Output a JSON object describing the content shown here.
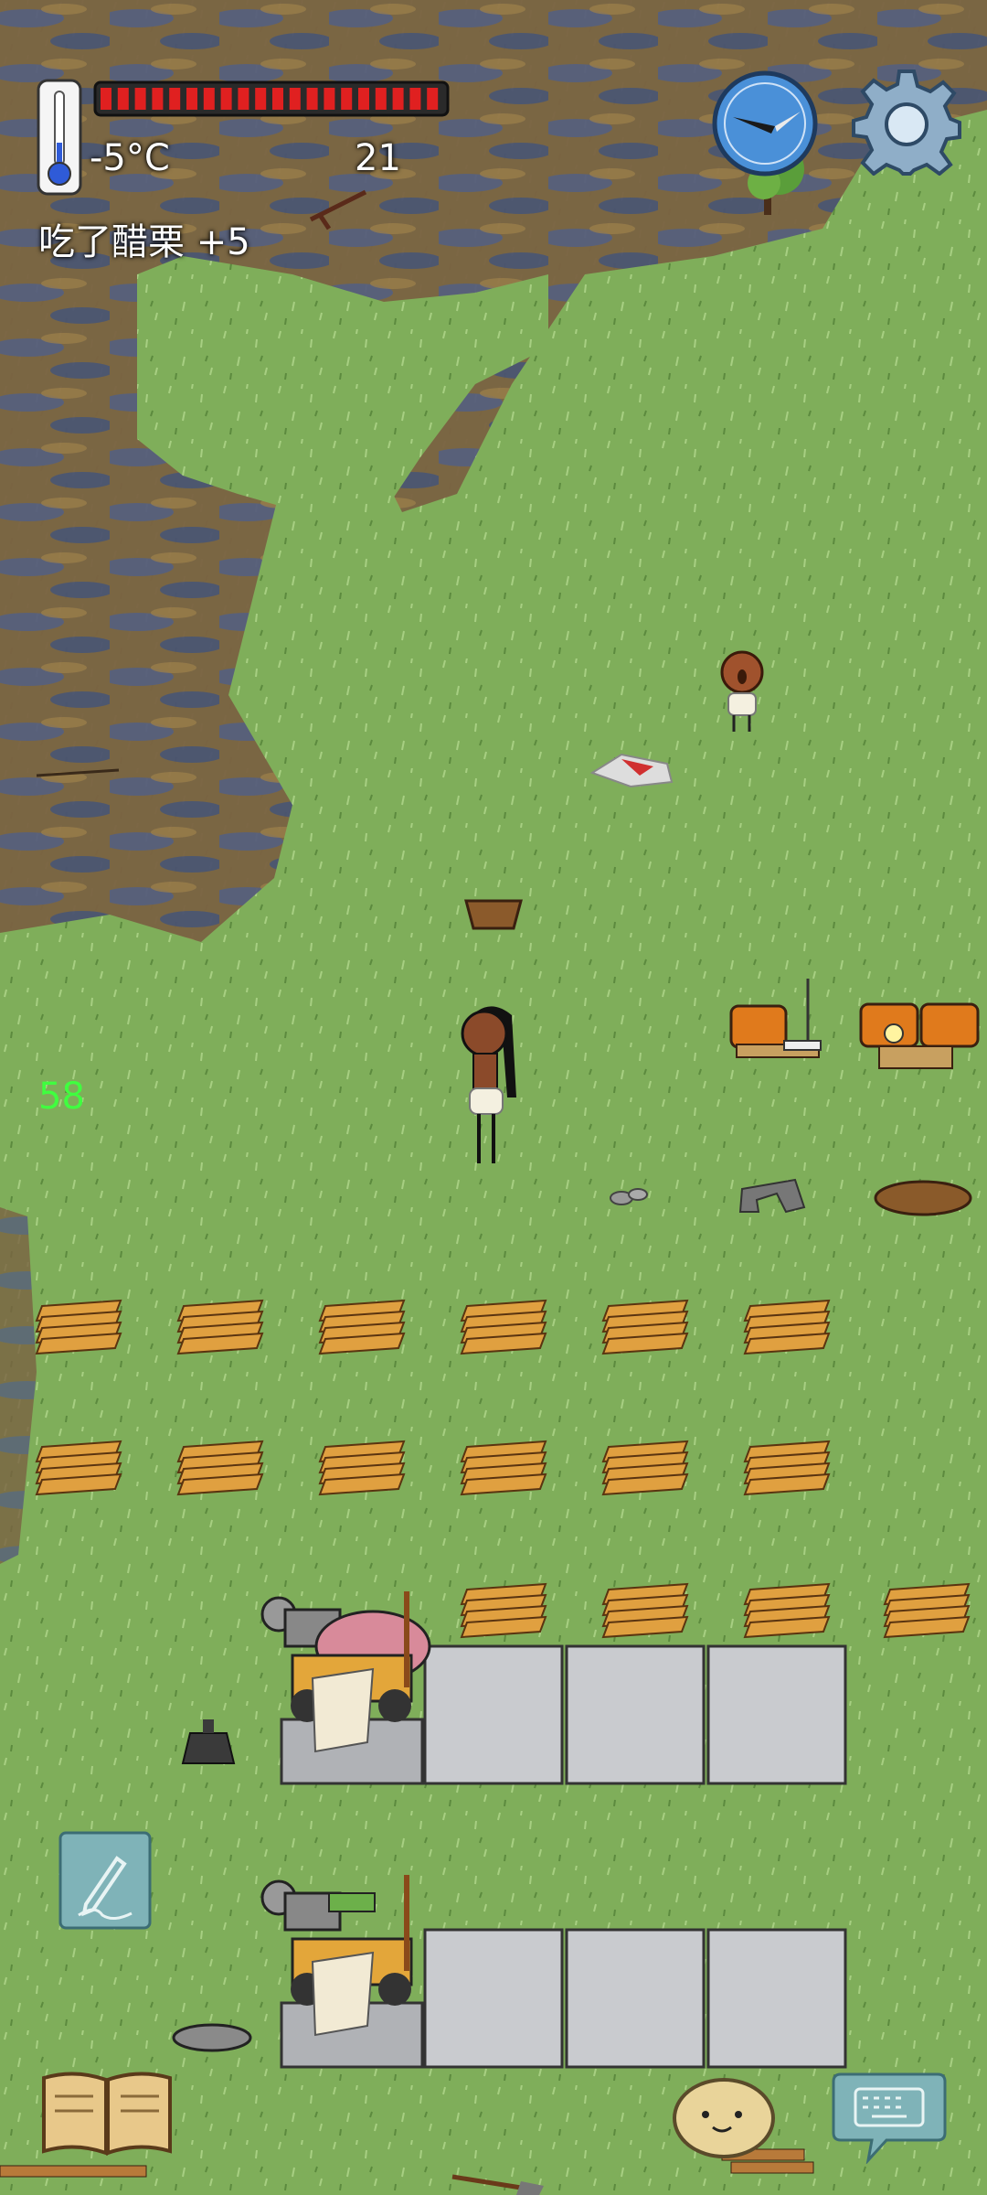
{
  "hud": {
    "temperature": "-5°C",
    "food_counter": "21",
    "message": "吃了醋栗 +5",
    "fps": "58",
    "food_bar_fill": 1.0
  },
  "colors": {
    "grass": "#7fae5a",
    "water": "#5b6a8c",
    "dirt": "#8a6a3a",
    "health_red": "#e02020",
    "fps_green": "#3fff3f"
  },
  "icons": {
    "thermometer": "thermometer-icon",
    "compass": "compass-icon",
    "settings": "gear-icon",
    "edit": "pencil-icon",
    "recipe_book": "book-icon",
    "emote": "face-icon",
    "chat": "keyboard-icon"
  }
}
